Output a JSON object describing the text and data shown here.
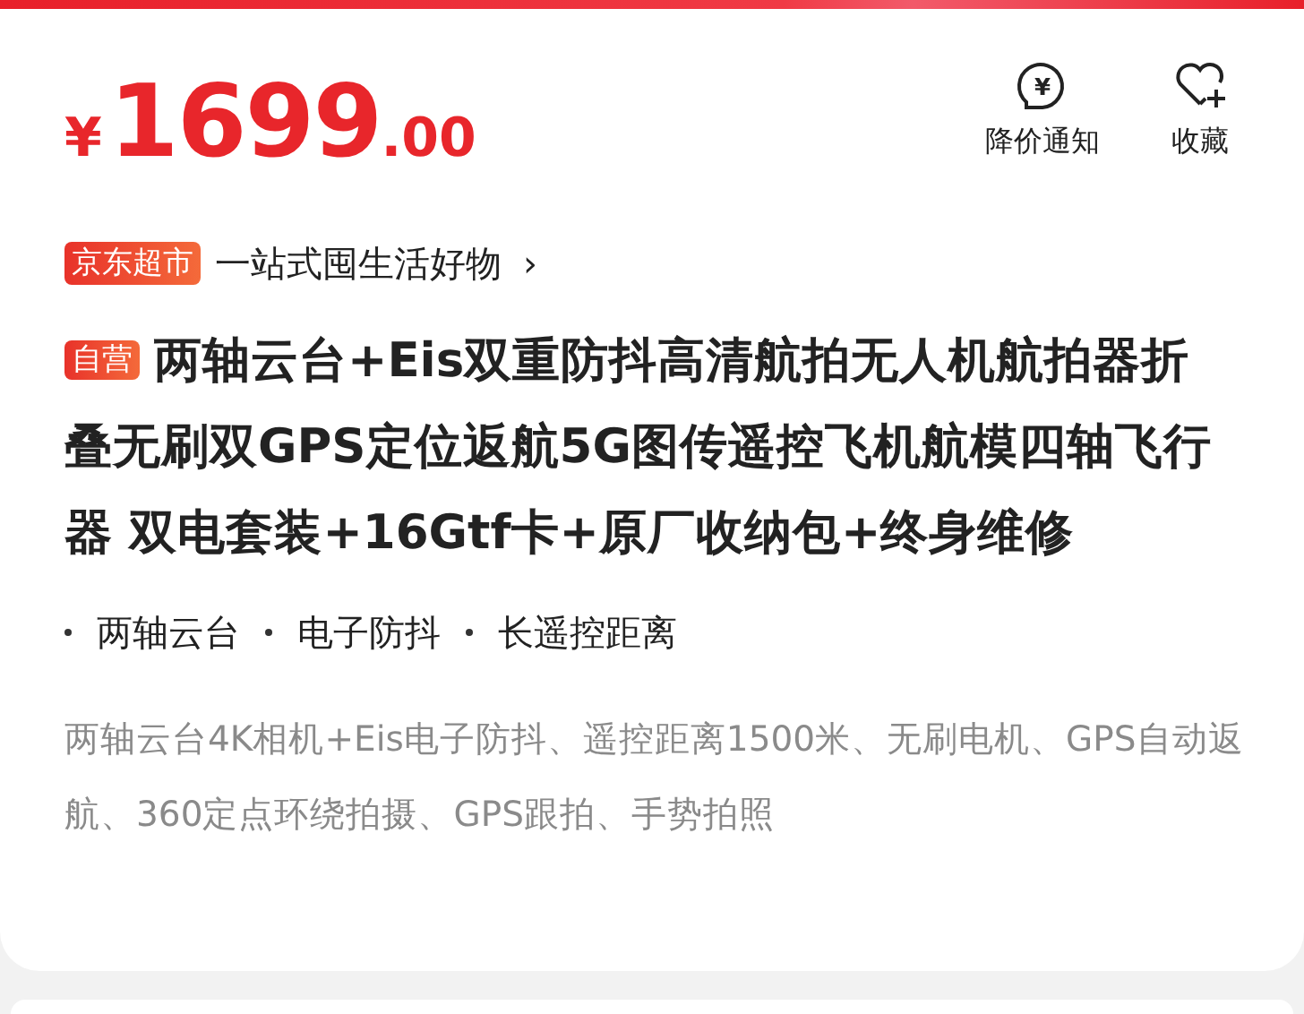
{
  "price": {
    "currency": "¥",
    "integer": "1699",
    "decimal": ".00"
  },
  "actions": [
    {
      "kind": "price-alert",
      "icon": "¥",
      "label": "降价通知"
    },
    {
      "kind": "favorite",
      "label": "收藏"
    }
  ],
  "store": {
    "tag": "京东超市",
    "slogan": "一站式囤生活好物",
    "chevron": "›"
  },
  "product": {
    "badge": "自营",
    "title": "两轴云台+Eis双重防抖高清航拍无人机航拍器折叠无刷双GPS定位返航5G图传遥控飞机航模四轴飞行器 双电套装+16Gtf卡+原厂收纳包+终身维修"
  },
  "features": [
    "两轴云台",
    "电子防抖",
    "长遥控距离"
  ],
  "description": "两轴云台4K相机+Eis电子防抖、遥控距离1500米、无刷电机、GPS自动返航、360定点环绕拍摄、GPS跟拍、手势拍照"
}
